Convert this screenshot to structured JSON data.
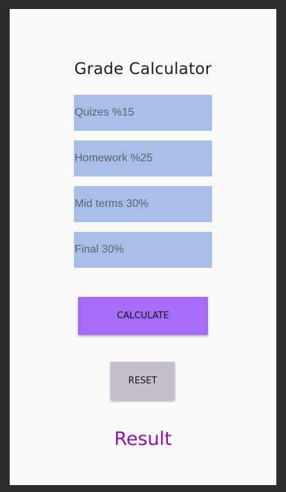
{
  "app": {
    "title": "Grade Calculator"
  },
  "fields": [
    {
      "placeholder": "Quizes %15",
      "value": ""
    },
    {
      "placeholder": "Homework %25",
      "value": ""
    },
    {
      "placeholder": "Mid terms 30%",
      "value": ""
    },
    {
      "placeholder": "Final 30%",
      "value": ""
    }
  ],
  "buttons": {
    "calculate_label": "CALCULATE",
    "reset_label": "RESET"
  },
  "result": {
    "text": "Result"
  },
  "colors": {
    "background": "#f9f9f9",
    "frame": "#2b2c2e",
    "field": "#a7bee6",
    "calculate_button": "#a56cf9",
    "reset_button": "#c5bfcb",
    "result_text": "#8c12ae"
  }
}
